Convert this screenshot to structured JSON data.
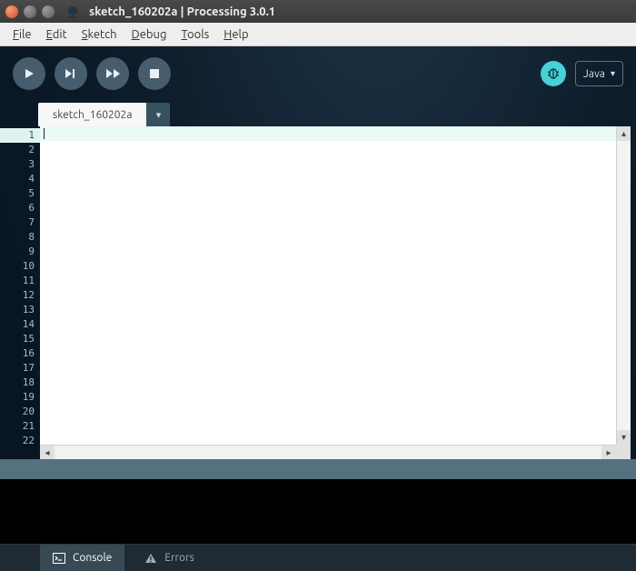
{
  "window": {
    "title": "sketch_160202a | Processing 3.0.1",
    "controls": {
      "close": "close",
      "minimize": "minimize",
      "maximize": "maximize"
    }
  },
  "menubar": {
    "file": "File",
    "edit": "Edit",
    "sketch": "Sketch",
    "debug": "Debug",
    "tools": "Tools",
    "help": "Help"
  },
  "toolbar": {
    "run": "Run",
    "step": "Run (present)",
    "run_debug": "Debug",
    "stop": "Stop",
    "debug_badge": "debug",
    "mode_label": "Java",
    "mode_dropdown_glyph": "▾"
  },
  "tabs": {
    "active": "sketch_160202a",
    "dropdown_glyph": "▾"
  },
  "editor": {
    "visible_line_count": 22,
    "current_line": 1,
    "content": ""
  },
  "bottom_tabs": {
    "console": "Console",
    "errors": "Errors"
  }
}
